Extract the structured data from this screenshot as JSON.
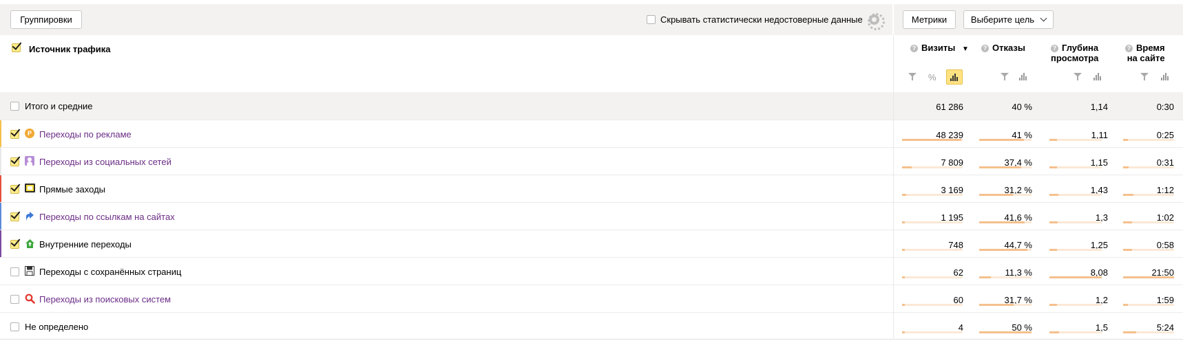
{
  "toolbar": {
    "groupings_label": "Группировки",
    "hide_unreliable_label": "Скрывать статистически недостоверные данные",
    "metrics_label": "Метрики",
    "goal_label": "Выберите цель"
  },
  "table": {
    "dimension_header": "Источник трафика",
    "columns": [
      {
        "line1": "Визиты",
        "line2": "",
        "sort": "▼"
      },
      {
        "line1": "Отказы",
        "line2": ""
      },
      {
        "line1": "Глубина",
        "line2": "просмотра"
      },
      {
        "line1": "Время",
        "line2": "на сайте"
      }
    ],
    "total": {
      "label": "Итого и средние",
      "visits": "61 286",
      "bounce": "40 %",
      "depth": "1,14",
      "time": "0:30"
    },
    "rows": [
      {
        "label": "Переходы по рекламе",
        "checked": true,
        "link": true,
        "icon": "ad-coin-icon",
        "accent": "#f5c04a",
        "visits": "48 239",
        "bounce": "41 %",
        "depth": "1,11",
        "time": "0:25",
        "bars": {
          "visits": 0.98,
          "bounce": 0.85,
          "depth": 0.14,
          "time": 0.1
        }
      },
      {
        "label": "Переходы из социальных сетей",
        "checked": true,
        "link": true,
        "icon": "social-person-icon",
        "accent": "#e8e8e8",
        "visits": "7 809",
        "bounce": "37,4 %",
        "depth": "1,15",
        "time": "0:31",
        "bars": {
          "visits": 0.16,
          "bounce": 0.8,
          "depth": 0.14,
          "time": 0.11
        }
      },
      {
        "label": "Прямые заходы",
        "checked": true,
        "link": false,
        "icon": "direct-window-icon",
        "accent": "#e3503e",
        "visits": "3 169",
        "bounce": "31,2 %",
        "depth": "1,43",
        "time": "1:12",
        "bars": {
          "visits": 0.07,
          "bounce": 0.65,
          "depth": 0.17,
          "time": 0.2
        }
      },
      {
        "label": "Переходы по ссылкам на сайтах",
        "checked": true,
        "link": true,
        "icon": "link-arrow-icon",
        "accent": "#5b8bd8",
        "visits": "1 195",
        "bounce": "41,6 %",
        "depth": "1,3",
        "time": "1:02",
        "bars": {
          "visits": 0.03,
          "bounce": 0.87,
          "depth": 0.16,
          "time": 0.18
        }
      },
      {
        "label": "Внутренние переходы",
        "checked": true,
        "link": false,
        "icon": "internal-house-icon",
        "accent": "#7c4a9e",
        "visits": "748",
        "bounce": "44,7 %",
        "depth": "1,25",
        "time": "0:58",
        "bars": {
          "visits": 0.02,
          "bounce": 0.92,
          "depth": 0.15,
          "time": 0.17
        }
      },
      {
        "label": "Переходы с сохранённых страниц",
        "checked": false,
        "link": false,
        "icon": "saved-disk-icon",
        "accent": "",
        "visits": "62",
        "bounce": "11,3 %",
        "depth": "8,08",
        "time": "21:50",
        "bars": {
          "visits": 0.01,
          "bounce": 0.23,
          "depth": 1.0,
          "time": 1.0
        }
      },
      {
        "label": "Переходы из поисковых систем",
        "checked": false,
        "link": true,
        "icon": "search-magnifier-icon",
        "accent": "",
        "visits": "60",
        "bounce": "31,7 %",
        "depth": "1,2",
        "time": "1:59",
        "bars": {
          "visits": 0.01,
          "bounce": 0.66,
          "depth": 0.15,
          "time": 0.1
        }
      },
      {
        "label": "Не определено",
        "checked": false,
        "link": false,
        "icon": "",
        "accent": "",
        "visits": "4",
        "bounce": "50 %",
        "depth": "1,5",
        "time": "5:24",
        "bars": {
          "visits": 0.01,
          "bounce": 1.0,
          "depth": 0.19,
          "time": 0.25
        }
      }
    ]
  }
}
